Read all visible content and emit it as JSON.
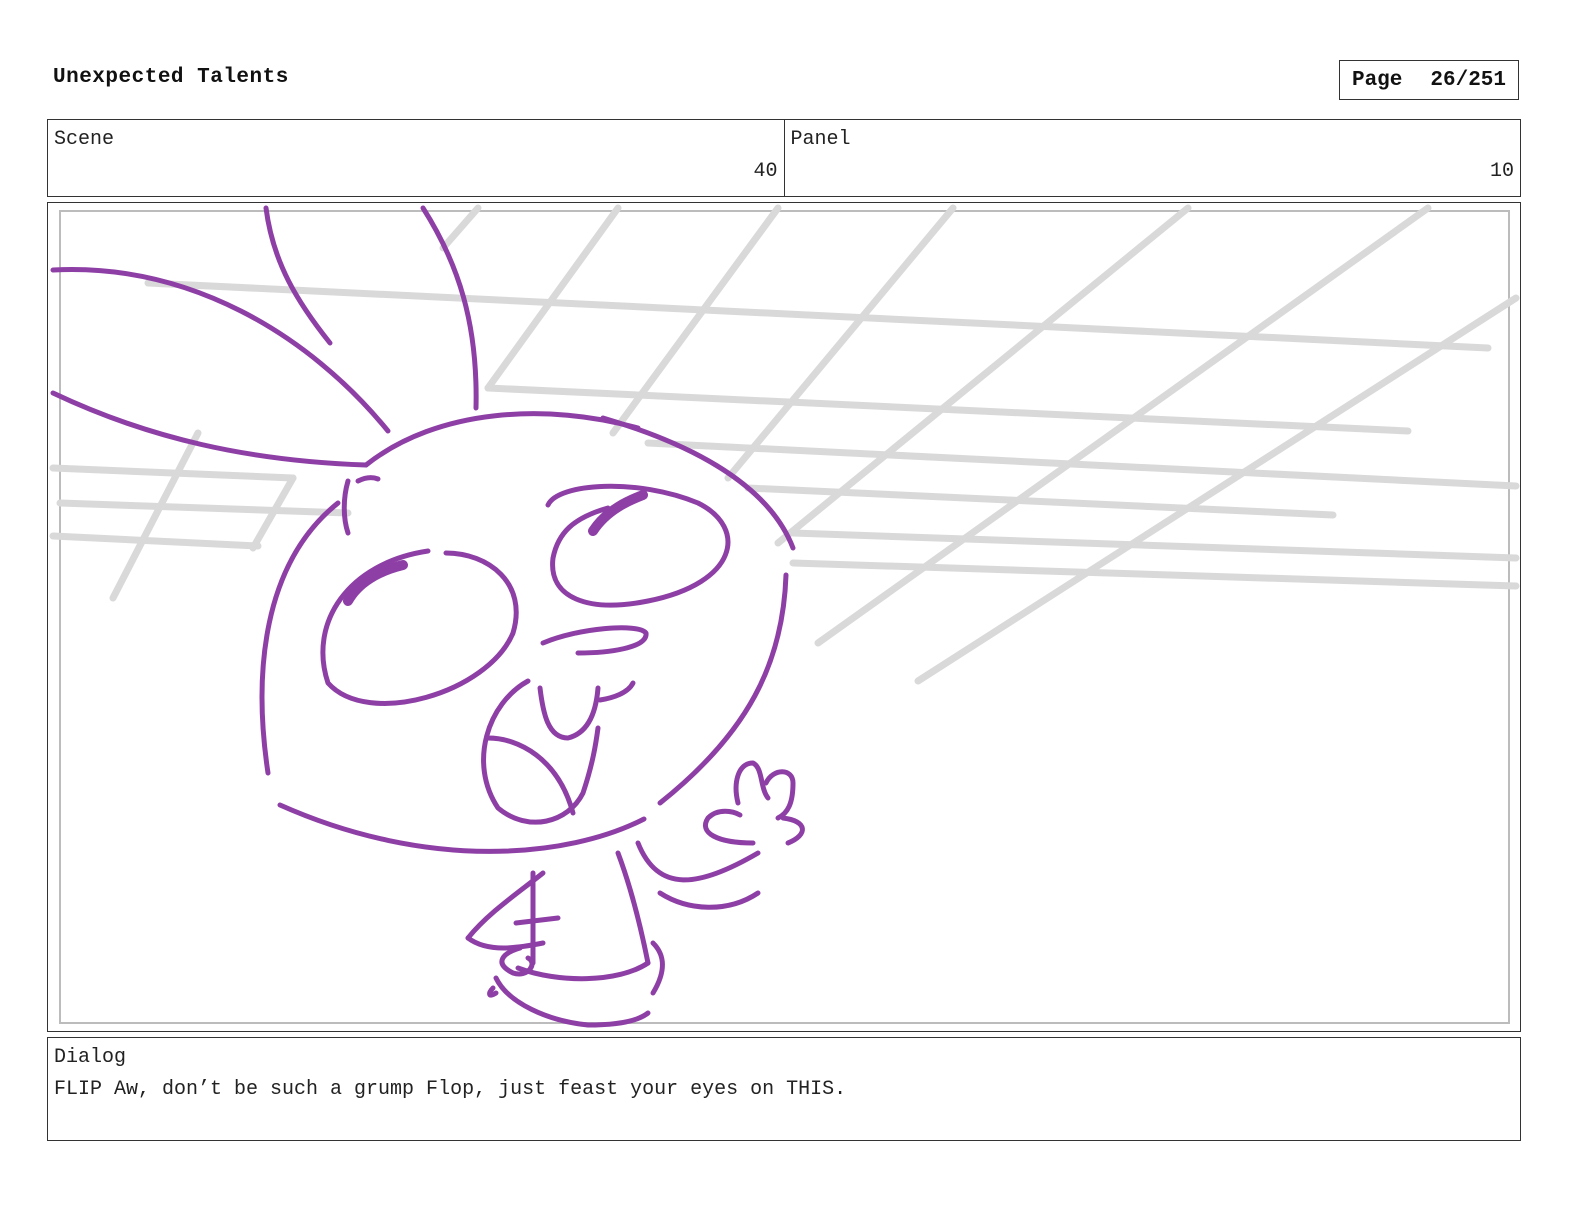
{
  "header": {
    "title": "Unexpected Talents",
    "page_label": "Page",
    "page_number": "26/251"
  },
  "info": {
    "scene_label": "Scene",
    "scene_value": "40",
    "panel_label": "Panel",
    "panel_value": "10"
  },
  "dialog": {
    "label": "Dialog",
    "text": "FLIP Aw, don’t be such a grump Flop, just feast your eyes on THIS."
  },
  "colors": {
    "sketch_stroke": "#8e3fa6",
    "grid_stroke": "#d9d9d9",
    "border": "#333333"
  }
}
